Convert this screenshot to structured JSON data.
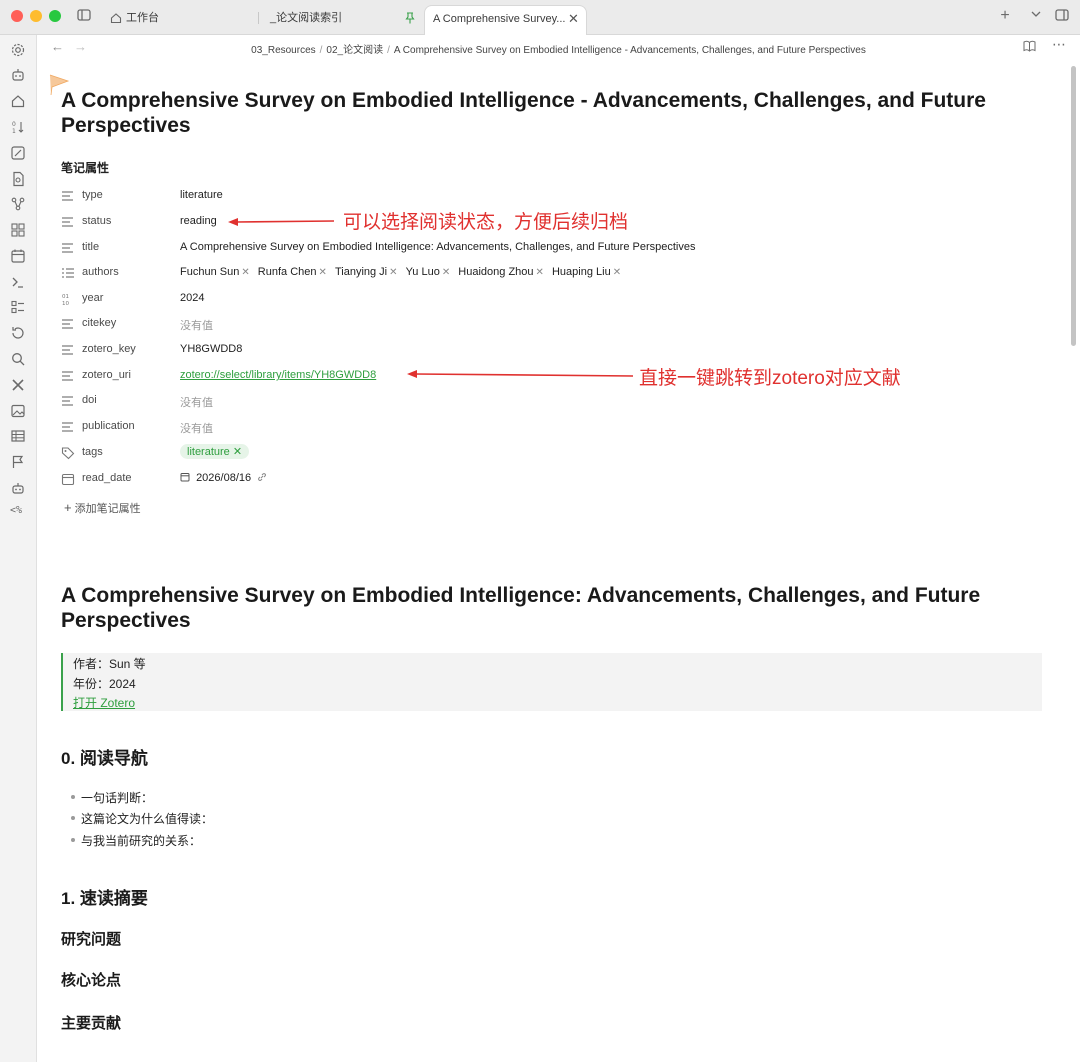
{
  "tabs": [
    {
      "label": "工作台",
      "icon": "home-icon"
    },
    {
      "label": "_论文阅读索引",
      "icon": ""
    },
    {
      "label": "A Comprehensive Survey...",
      "icon": "pin-icon",
      "active": true
    }
  ],
  "breadcrumb": [
    "03_Resources",
    "02_论文阅读",
    "A Comprehensive Survey on Embodied Intelligence -  Advancements, Challenges, and Future Perspectives"
  ],
  "note": {
    "title": "A Comprehensive Survey on Embodied Intelligence -  Advancements, Challenges, and Future Perspectives",
    "properties_heading": "笔记属性",
    "properties": {
      "type": {
        "key": "type",
        "value": "literature"
      },
      "status": {
        "key": "status",
        "value": "reading"
      },
      "title": {
        "key": "title",
        "value": "A Comprehensive Survey on Embodied Intelligence: Advancements, Challenges, and Future Perspectives"
      },
      "authors": {
        "key": "authors",
        "values": [
          "Fuchun Sun",
          "Runfa Chen",
          "Tianying Ji",
          "Yu Luo",
          "Huaidong Zhou",
          "Huaping Liu"
        ]
      },
      "year": {
        "key": "year",
        "value": "2024"
      },
      "citekey": {
        "key": "citekey",
        "value": "没有值"
      },
      "zotero_key": {
        "key": "zotero_key",
        "value": "YH8GWDD8"
      },
      "zotero_uri": {
        "key": "zotero_uri",
        "value": "zotero://select/library/items/YH8GWDD8"
      },
      "doi": {
        "key": "doi",
        "value": "没有值"
      },
      "publication": {
        "key": "publication",
        "value": "没有值"
      },
      "tags": {
        "key": "tags",
        "value": "literature"
      },
      "read_date": {
        "key": "read_date",
        "value": "2026/08/16"
      }
    },
    "add_property": "添加笔记属性"
  },
  "annotations": {
    "status_note": "可以选择阅读状态，方便后续归档",
    "zotero_note": "直接一键跳转到zotero对应文献"
  },
  "body": {
    "title": "A Comprehensive Survey on Embodied Intelligence: Advancements, Challenges, and Future Perspectives",
    "callout": {
      "author": "作者：Sun 等",
      "year": "年份：2024",
      "link": "打开 Zotero"
    },
    "section0": {
      "heading": "0. 阅读导航",
      "bullets": [
        "一句话判断：",
        "这篇论文为什么值得读：",
        "与我当前研究的关系："
      ]
    },
    "section1": {
      "heading": "1. 速读摘要",
      "sub1": "研究问题",
      "sub2": "核心论点",
      "sub3": "主要贡献"
    }
  },
  "colors": {
    "accent": "#2e9e3e",
    "annotation": "#e0312f"
  }
}
